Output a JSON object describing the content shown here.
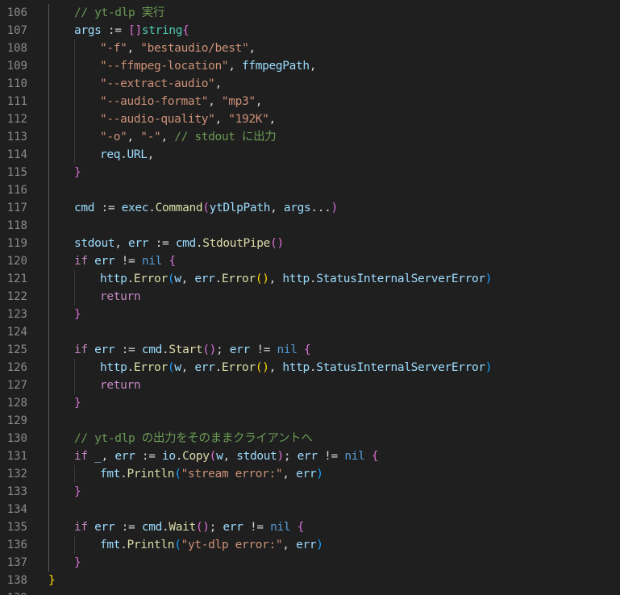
{
  "colors": {
    "background": "#1f1f1f",
    "line_number": "#8b8b8b",
    "plain": "#d4d4d4",
    "variable": "#9cdcfe",
    "string": "#ce9178",
    "comment": "#6a9955",
    "control_keyword": "#c586c0",
    "keyword": "#569cd6",
    "type": "#4ec9b0",
    "function": "#dcdcaa",
    "bracket_level1": "#ffd700",
    "bracket_level2": "#da70d6",
    "bracket_level3": "#179fff"
  },
  "lines": [
    {
      "n": "106",
      "indent": 1,
      "tokens": [
        [
          "comment",
          "// yt-dlp 実行"
        ]
      ]
    },
    {
      "n": "107",
      "indent": 1,
      "tokens": [
        [
          "var",
          "args"
        ],
        [
          "op",
          " := "
        ],
        [
          "br2",
          "[]"
        ],
        [
          "type",
          "string"
        ],
        [
          "br2",
          "{"
        ]
      ]
    },
    {
      "n": "108",
      "indent": 2,
      "tokens": [
        [
          "str",
          "\"-f\""
        ],
        [
          "op",
          ", "
        ],
        [
          "str",
          "\"bestaudio/best\""
        ],
        [
          "op",
          ","
        ]
      ]
    },
    {
      "n": "109",
      "indent": 2,
      "tokens": [
        [
          "str",
          "\"--ffmpeg-location\""
        ],
        [
          "op",
          ", "
        ],
        [
          "var",
          "ffmpegPath"
        ],
        [
          "op",
          ","
        ]
      ]
    },
    {
      "n": "110",
      "indent": 2,
      "tokens": [
        [
          "str",
          "\"--extract-audio\""
        ],
        [
          "op",
          ","
        ]
      ]
    },
    {
      "n": "111",
      "indent": 2,
      "tokens": [
        [
          "str",
          "\"--audio-format\""
        ],
        [
          "op",
          ", "
        ],
        [
          "str",
          "\"mp3\""
        ],
        [
          "op",
          ","
        ]
      ]
    },
    {
      "n": "112",
      "indent": 2,
      "tokens": [
        [
          "str",
          "\"--audio-quality\""
        ],
        [
          "op",
          ", "
        ],
        [
          "str",
          "\"192K\""
        ],
        [
          "op",
          ","
        ]
      ]
    },
    {
      "n": "113",
      "indent": 2,
      "tokens": [
        [
          "str",
          "\"-o\""
        ],
        [
          "op",
          ", "
        ],
        [
          "str",
          "\"-\""
        ],
        [
          "op",
          ", "
        ],
        [
          "comment",
          "// stdout に出力"
        ]
      ]
    },
    {
      "n": "114",
      "indent": 2,
      "tokens": [
        [
          "var",
          "req"
        ],
        [
          "op",
          "."
        ],
        [
          "var",
          "URL"
        ],
        [
          "op",
          ","
        ]
      ]
    },
    {
      "n": "115",
      "indent": 1,
      "tokens": [
        [
          "br2",
          "}"
        ]
      ]
    },
    {
      "n": "116",
      "indent": 0,
      "tokens": []
    },
    {
      "n": "117",
      "indent": 1,
      "tokens": [
        [
          "var",
          "cmd"
        ],
        [
          "op",
          " := "
        ],
        [
          "var",
          "exec"
        ],
        [
          "op",
          "."
        ],
        [
          "func",
          "Command"
        ],
        [
          "br2",
          "("
        ],
        [
          "var",
          "ytDlpPath"
        ],
        [
          "op",
          ", "
        ],
        [
          "var",
          "args"
        ],
        [
          "op",
          "..."
        ],
        [
          "br2",
          ")"
        ]
      ]
    },
    {
      "n": "118",
      "indent": 0,
      "tokens": []
    },
    {
      "n": "119",
      "indent": 1,
      "tokens": [
        [
          "var",
          "stdout"
        ],
        [
          "op",
          ", "
        ],
        [
          "var",
          "err"
        ],
        [
          "op",
          " := "
        ],
        [
          "var",
          "cmd"
        ],
        [
          "op",
          "."
        ],
        [
          "func",
          "StdoutPipe"
        ],
        [
          "br2",
          "()"
        ]
      ]
    },
    {
      "n": "120",
      "indent": 1,
      "tokens": [
        [
          "kw",
          "if"
        ],
        [
          "op",
          " "
        ],
        [
          "var",
          "err"
        ],
        [
          "op",
          " != "
        ],
        [
          "keyword",
          "nil"
        ],
        [
          "op",
          " "
        ],
        [
          "br2",
          "{"
        ]
      ]
    },
    {
      "n": "121",
      "indent": 2,
      "tokens": [
        [
          "var",
          "http"
        ],
        [
          "op",
          "."
        ],
        [
          "func",
          "Error"
        ],
        [
          "br3",
          "("
        ],
        [
          "var",
          "w"
        ],
        [
          "op",
          ", "
        ],
        [
          "var",
          "err"
        ],
        [
          "op",
          "."
        ],
        [
          "func",
          "Error"
        ],
        [
          "br1",
          "()"
        ],
        [
          "op",
          ", "
        ],
        [
          "var",
          "http"
        ],
        [
          "op",
          "."
        ],
        [
          "var",
          "StatusInternalServerError"
        ],
        [
          "br3",
          ")"
        ]
      ]
    },
    {
      "n": "122",
      "indent": 2,
      "tokens": [
        [
          "kw",
          "return"
        ]
      ]
    },
    {
      "n": "123",
      "indent": 1,
      "tokens": [
        [
          "br2",
          "}"
        ]
      ]
    },
    {
      "n": "124",
      "indent": 0,
      "tokens": []
    },
    {
      "n": "125",
      "indent": 1,
      "tokens": [
        [
          "kw",
          "if"
        ],
        [
          "op",
          " "
        ],
        [
          "var",
          "err"
        ],
        [
          "op",
          " := "
        ],
        [
          "var",
          "cmd"
        ],
        [
          "op",
          "."
        ],
        [
          "func",
          "Start"
        ],
        [
          "br2",
          "()"
        ],
        [
          "op",
          "; "
        ],
        [
          "var",
          "err"
        ],
        [
          "op",
          " != "
        ],
        [
          "keyword",
          "nil"
        ],
        [
          "op",
          " "
        ],
        [
          "br2",
          "{"
        ]
      ]
    },
    {
      "n": "126",
      "indent": 2,
      "tokens": [
        [
          "var",
          "http"
        ],
        [
          "op",
          "."
        ],
        [
          "func",
          "Error"
        ],
        [
          "br3",
          "("
        ],
        [
          "var",
          "w"
        ],
        [
          "op",
          ", "
        ],
        [
          "var",
          "err"
        ],
        [
          "op",
          "."
        ],
        [
          "func",
          "Error"
        ],
        [
          "br1",
          "()"
        ],
        [
          "op",
          ", "
        ],
        [
          "var",
          "http"
        ],
        [
          "op",
          "."
        ],
        [
          "var",
          "StatusInternalServerError"
        ],
        [
          "br3",
          ")"
        ]
      ]
    },
    {
      "n": "127",
      "indent": 2,
      "tokens": [
        [
          "kw",
          "return"
        ]
      ]
    },
    {
      "n": "128",
      "indent": 1,
      "tokens": [
        [
          "br2",
          "}"
        ]
      ]
    },
    {
      "n": "129",
      "indent": 0,
      "tokens": []
    },
    {
      "n": "130",
      "indent": 1,
      "tokens": [
        [
          "comment",
          "// yt-dlp の出力をそのままクライアントへ"
        ]
      ]
    },
    {
      "n": "131",
      "indent": 1,
      "tokens": [
        [
          "kw",
          "if"
        ],
        [
          "op",
          " "
        ],
        [
          "var",
          "_"
        ],
        [
          "op",
          ", "
        ],
        [
          "var",
          "err"
        ],
        [
          "op",
          " := "
        ],
        [
          "var",
          "io"
        ],
        [
          "op",
          "."
        ],
        [
          "func",
          "Copy"
        ],
        [
          "br2",
          "("
        ],
        [
          "var",
          "w"
        ],
        [
          "op",
          ", "
        ],
        [
          "var",
          "stdout"
        ],
        [
          "br2",
          ")"
        ],
        [
          "op",
          "; "
        ],
        [
          "var",
          "err"
        ],
        [
          "op",
          " != "
        ],
        [
          "keyword",
          "nil"
        ],
        [
          "op",
          " "
        ],
        [
          "br2",
          "{"
        ]
      ]
    },
    {
      "n": "132",
      "indent": 2,
      "tokens": [
        [
          "var",
          "fmt"
        ],
        [
          "op",
          "."
        ],
        [
          "func",
          "Println"
        ],
        [
          "br3",
          "("
        ],
        [
          "str",
          "\"stream error:\""
        ],
        [
          "op",
          ", "
        ],
        [
          "var",
          "err"
        ],
        [
          "br3",
          ")"
        ]
      ]
    },
    {
      "n": "133",
      "indent": 1,
      "tokens": [
        [
          "br2",
          "}"
        ]
      ]
    },
    {
      "n": "134",
      "indent": 0,
      "tokens": []
    },
    {
      "n": "135",
      "indent": 1,
      "tokens": [
        [
          "kw",
          "if"
        ],
        [
          "op",
          " "
        ],
        [
          "var",
          "err"
        ],
        [
          "op",
          " := "
        ],
        [
          "var",
          "cmd"
        ],
        [
          "op",
          "."
        ],
        [
          "func",
          "Wait"
        ],
        [
          "br2",
          "()"
        ],
        [
          "op",
          "; "
        ],
        [
          "var",
          "err"
        ],
        [
          "op",
          " != "
        ],
        [
          "keyword",
          "nil"
        ],
        [
          "op",
          " "
        ],
        [
          "br2",
          "{"
        ]
      ]
    },
    {
      "n": "136",
      "indent": 2,
      "tokens": [
        [
          "var",
          "fmt"
        ],
        [
          "op",
          "."
        ],
        [
          "func",
          "Println"
        ],
        [
          "br3",
          "("
        ],
        [
          "str",
          "\"yt-dlp error:\""
        ],
        [
          "op",
          ", "
        ],
        [
          "var",
          "err"
        ],
        [
          "br3",
          ")"
        ]
      ]
    },
    {
      "n": "137",
      "indent": 1,
      "tokens": [
        [
          "br2",
          "}"
        ]
      ]
    },
    {
      "n": "138",
      "indent": 0,
      "tokens": [
        [
          "br1",
          "}"
        ]
      ]
    },
    {
      "n": "139",
      "indent": 0,
      "tokens": []
    }
  ]
}
